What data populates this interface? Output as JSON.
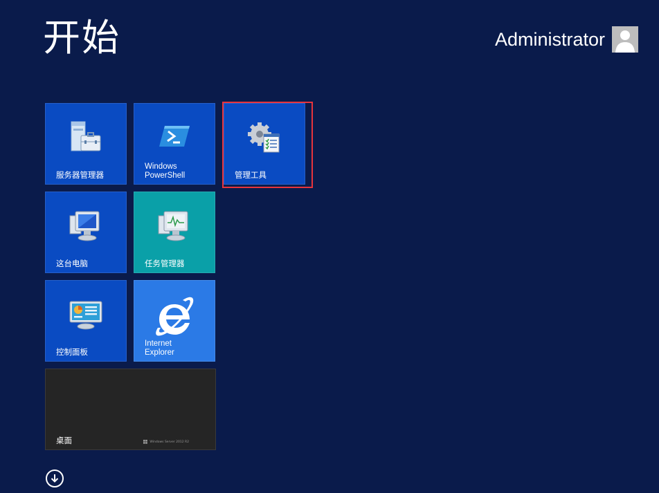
{
  "header": {
    "title": "开始",
    "user_name": "Administrator",
    "user_icon": "user-avatar-icon"
  },
  "tiles": [
    {
      "label": "服务器管理器",
      "icon": "server-manager-icon",
      "color": "#0a4bc2"
    },
    {
      "label": "Windows\nPowerShell",
      "icon": "powershell-icon",
      "color": "#0a4bc2"
    },
    {
      "label": "管理工具",
      "icon": "admin-tools-gear-icon",
      "color": "#0a4bc2",
      "highlighted": true,
      "highlight_color": "#e8343c"
    },
    {
      "label": "这台电脑",
      "icon": "computer-icon",
      "color": "#0a4bc2"
    },
    {
      "label": "任务管理器",
      "icon": "task-manager-icon",
      "color": "#0aa0a8"
    },
    {
      "label": "控制面板",
      "icon": "control-panel-icon",
      "color": "#0a4bc2"
    },
    {
      "label": "Internet\nExplorer",
      "icon": "internet-explorer-icon",
      "color": "#2b7ae6"
    },
    {
      "label": "桌面",
      "icon": "desktop-tile",
      "color": "#252525",
      "watermark": "Windows Server 2012 R2"
    }
  ],
  "footer": {
    "all_apps_icon": "down-arrow-circle-icon"
  }
}
